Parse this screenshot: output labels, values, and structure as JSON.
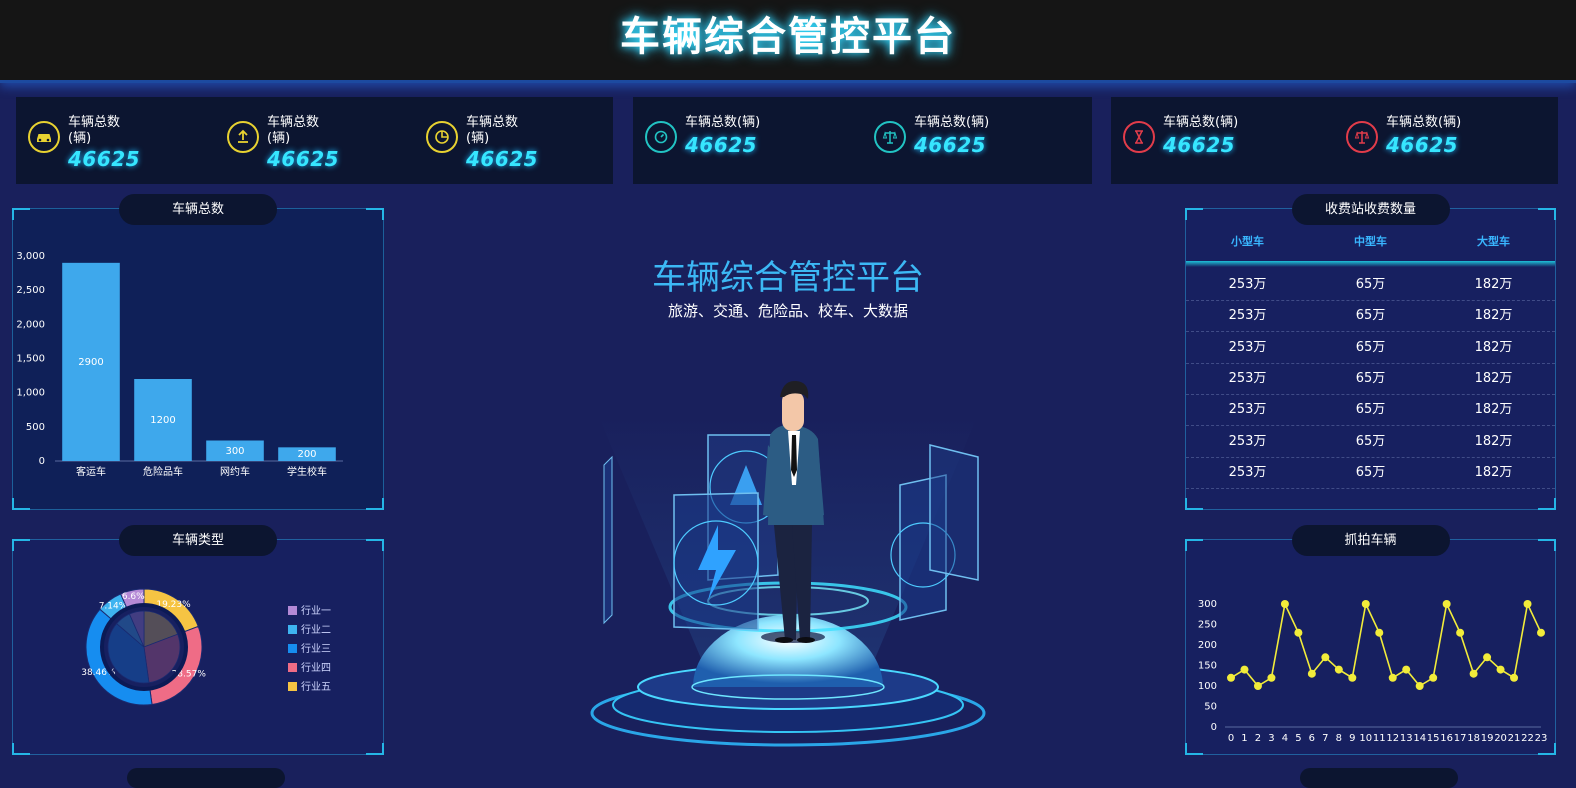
{
  "header": {
    "title": "车辆综合管控平台"
  },
  "stats": {
    "group1": [
      {
        "label_line1": "车辆总数",
        "label_line2": "(辆)",
        "value": "46625",
        "icon": "car-icon",
        "color": "#e8d231"
      },
      {
        "label_line1": "车辆总数",
        "label_line2": "(辆)",
        "value": "46625",
        "icon": "upload-icon",
        "color": "#e8d231"
      },
      {
        "label_line1": "车辆总数",
        "label_line2": "(辆)",
        "value": "46625",
        "icon": "pie-icon",
        "color": "#e8d231"
      }
    ],
    "group2": [
      {
        "label": "车辆总数(辆)",
        "value": "46625",
        "icon": "timer-icon",
        "color": "#22c3c3"
      },
      {
        "label": "车辆总数(辆)",
        "value": "46625",
        "icon": "balance-icon",
        "color": "#22c3c3"
      }
    ],
    "group3": [
      {
        "label": "车辆总数(辆)",
        "value": "46625",
        "icon": "hourglass-icon",
        "color": "#e23c4a"
      },
      {
        "label": "车辆总数(辆)",
        "value": "46625",
        "icon": "scale-icon",
        "color": "#e23c4a"
      }
    ]
  },
  "panels": {
    "vehicle_total": {
      "title": "车辆总数"
    },
    "vehicle_type": {
      "title": "车辆类型"
    },
    "toll": {
      "title": "收费站收费数量"
    },
    "capture": {
      "title": "抓拍车辆"
    }
  },
  "center": {
    "title": "车辆综合管控平台",
    "subtitle": "旅游、交通、危险品、校车、大数据"
  },
  "toll_table": {
    "headers": [
      "小型车",
      "中型车",
      "大型车"
    ],
    "rows": [
      [
        "253万",
        "65万",
        "182万"
      ],
      [
        "253万",
        "65万",
        "182万"
      ],
      [
        "253万",
        "65万",
        "182万"
      ],
      [
        "253万",
        "65万",
        "182万"
      ],
      [
        "253万",
        "65万",
        "182万"
      ],
      [
        "253万",
        "65万",
        "182万"
      ],
      [
        "253万",
        "65万",
        "182万"
      ]
    ]
  },
  "chart_data": [
    {
      "type": "bar",
      "categories": [
        "客运车",
        "危险品车",
        "网约车",
        "学生校车"
      ],
      "values": [
        2900,
        1200,
        300,
        200
      ],
      "ylim": [
        0,
        3000
      ],
      "yticks": [
        "0",
        "500",
        "1,000",
        "1,500",
        "2,000",
        "2,500",
        "3,000"
      ],
      "color": "#3ea8ec"
    },
    {
      "type": "pie",
      "labels": [
        "行业一",
        "行业二",
        "行业三",
        "行业四",
        "行业五"
      ],
      "values": [
        6.6,
        7.14,
        38.46,
        28.57,
        19.23
      ],
      "value_labels": [
        "6.6%",
        "7.14%",
        "38.46%",
        "28.57%",
        "19.23%"
      ],
      "colors": [
        "#b489d6",
        "#3eb3f0",
        "#168df0",
        "#ef6c86",
        "#f6c443"
      ],
      "legend_position": "right"
    },
    {
      "type": "line",
      "x": [
        "0",
        "1",
        "2",
        "3",
        "4",
        "5",
        "6",
        "7",
        "8",
        "9",
        "10",
        "11",
        "12",
        "13",
        "14",
        "15",
        "16",
        "17",
        "18",
        "19",
        "20",
        "21",
        "22",
        "23"
      ],
      "values": [
        120,
        140,
        100,
        120,
        300,
        230,
        130,
        170,
        140,
        120,
        300,
        230,
        120,
        140,
        100,
        120,
        300,
        230,
        130,
        170,
        140,
        120,
        300,
        230
      ],
      "ylim": [
        0,
        300
      ],
      "yticks": [
        "0",
        "50",
        "100",
        "150",
        "200",
        "250",
        "300"
      ],
      "color": "#f2ec3a"
    }
  ]
}
